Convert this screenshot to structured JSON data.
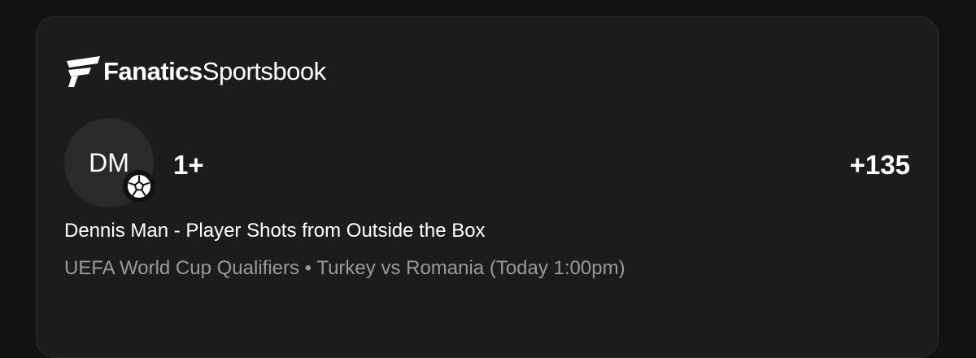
{
  "brand": {
    "name_bold": "Fanatics",
    "name_light": "Sportsbook",
    "logo_icon": "fanatics-flag-logo"
  },
  "bet": {
    "player_initials": "DM",
    "sport_icon": "soccer-ball-icon",
    "line": "1+",
    "odds": "+135",
    "market": "Dennis Man - Player Shots from Outside the Box",
    "competition": "UEFA World Cup Qualifiers",
    "separator": "•",
    "matchup": "Turkey vs Romania (Today 1:00pm)"
  },
  "colors": {
    "background": "#121212",
    "card": "#1c1c1c",
    "avatar": "#2a2a2a",
    "primary_text": "#ffffff",
    "secondary_text": "#9a9a9a"
  }
}
